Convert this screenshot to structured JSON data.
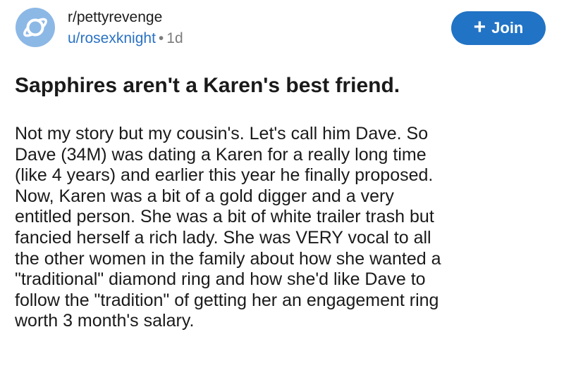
{
  "post": {
    "subreddit": "r/pettyrevenge",
    "author": "u/rosexknight",
    "separator": "•",
    "age": "1d",
    "join_label": "Join",
    "join_icon": "plus-icon",
    "title": "Sapphires aren't a Karen's best friend.",
    "body_lines": [
      "Not my story but my cousin's. Let's call him Dave. So",
      "Dave (34M) was dating a Karen for a really long time",
      "(like 4 years) and earlier this year he finally proposed.",
      "Now, Karen was a bit of a gold digger and a very",
      "entitled person. She was a bit of white trailer trash but",
      "fancied herself a rich lady. She was VERY vocal to all",
      "the other women in the family about how she wanted a",
      "\"traditional\" diamond ring and how she'd like Dave to",
      "follow the \"tradition\" of getting her an engagement ring",
      "worth 3 month's salary."
    ]
  },
  "colors": {
    "accent": "#2173c5",
    "username": "#2a72c4",
    "avatar_bg": "#8cb8e6",
    "muted": "#7c7c7c"
  }
}
